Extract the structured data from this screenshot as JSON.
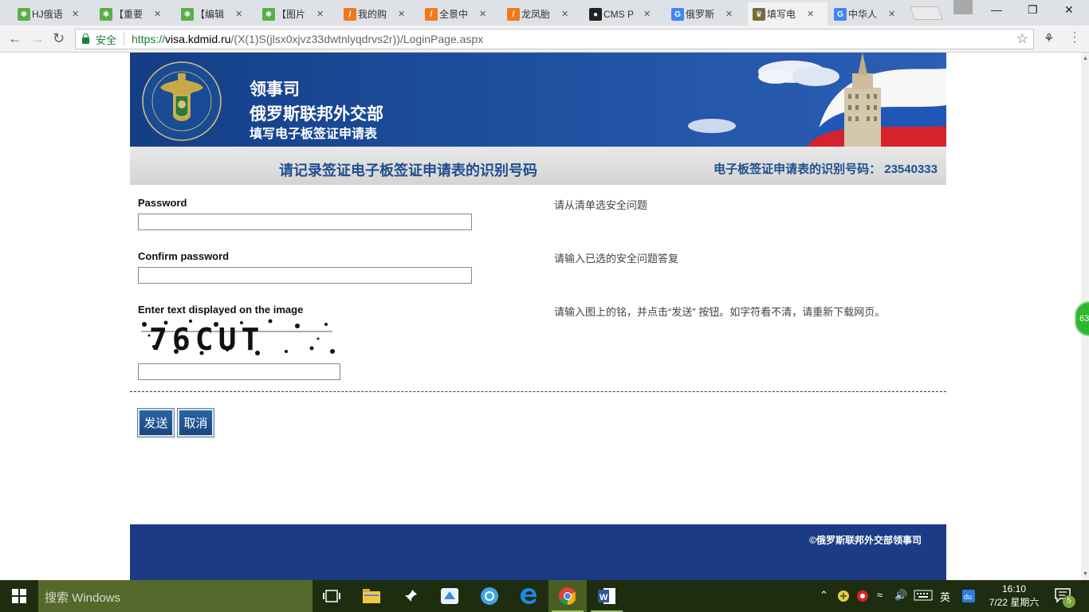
{
  "browser": {
    "tabs": [
      {
        "title": "HJ俄语",
        "favicon": "hj-icon",
        "color": "#5aae4a"
      },
      {
        "title": "【重要",
        "favicon": "hj-icon",
        "color": "#5aae4a"
      },
      {
        "title": "【编辑",
        "favicon": "hj-icon",
        "color": "#5aae4a"
      },
      {
        "title": "【图片",
        "favicon": "hj-icon",
        "color": "#5aae4a"
      },
      {
        "title": "我的购",
        "favicon": "aliyun-icon",
        "color": "#f07a1a"
      },
      {
        "title": "全景中",
        "favicon": "aliyun-icon",
        "color": "#f07a1a"
      },
      {
        "title": "龙凤胎",
        "favicon": "aliyun-icon",
        "color": "#f07a1a"
      },
      {
        "title": "CMS P",
        "favicon": "github-icon",
        "color": "#222222"
      },
      {
        "title": "俄罗斯",
        "favicon": "google-icon",
        "color": "#4285f4"
      },
      {
        "title": "填写电",
        "favicon": "emblem-icon",
        "color": "#7a6a3a"
      },
      {
        "title": "中华人",
        "favicon": "google-icon",
        "color": "#4285f4"
      }
    ],
    "active_tab_index": 9,
    "address": {
      "secure_label": "安全",
      "scheme": "https://",
      "host": "visa.kdmid.ru",
      "path": "/(X(1)S(jlsx0xjvz33dwtnlyqdrvs2r))/LoginPage.aspx"
    },
    "side_badge": "63"
  },
  "page": {
    "header": {
      "line1": "领事司",
      "line2": "俄罗斯联邦外交部",
      "line3": "填写电子板签证申请表"
    },
    "subbar": {
      "title": "请记录签证电子板签证申请表的识别号码",
      "id_label": "电子板签证申请表的识别号码：",
      "id_value": "23540333"
    },
    "form": {
      "password_label": "Password",
      "confirm_label": "Confirm password",
      "captcha_label": "Enter text displayed on the image",
      "captcha_text": "76CUT",
      "hint_question": "请从清单选安全问题",
      "hint_answer": "请输入已选的安全问题答复",
      "hint_captcha": "请输入图上的铭，并点击“发送” 按钮。如字符看不清，请重新下载网页。"
    },
    "buttons": {
      "submit": "发送",
      "cancel": "取消"
    },
    "footer": {
      "copyright": "©俄罗斯联邦外交部领事司"
    }
  },
  "taskbar": {
    "search_placeholder": "搜索 Windows",
    "ime": "英",
    "time": "16:10",
    "date": "7/22 星期六",
    "notifications": "5"
  }
}
